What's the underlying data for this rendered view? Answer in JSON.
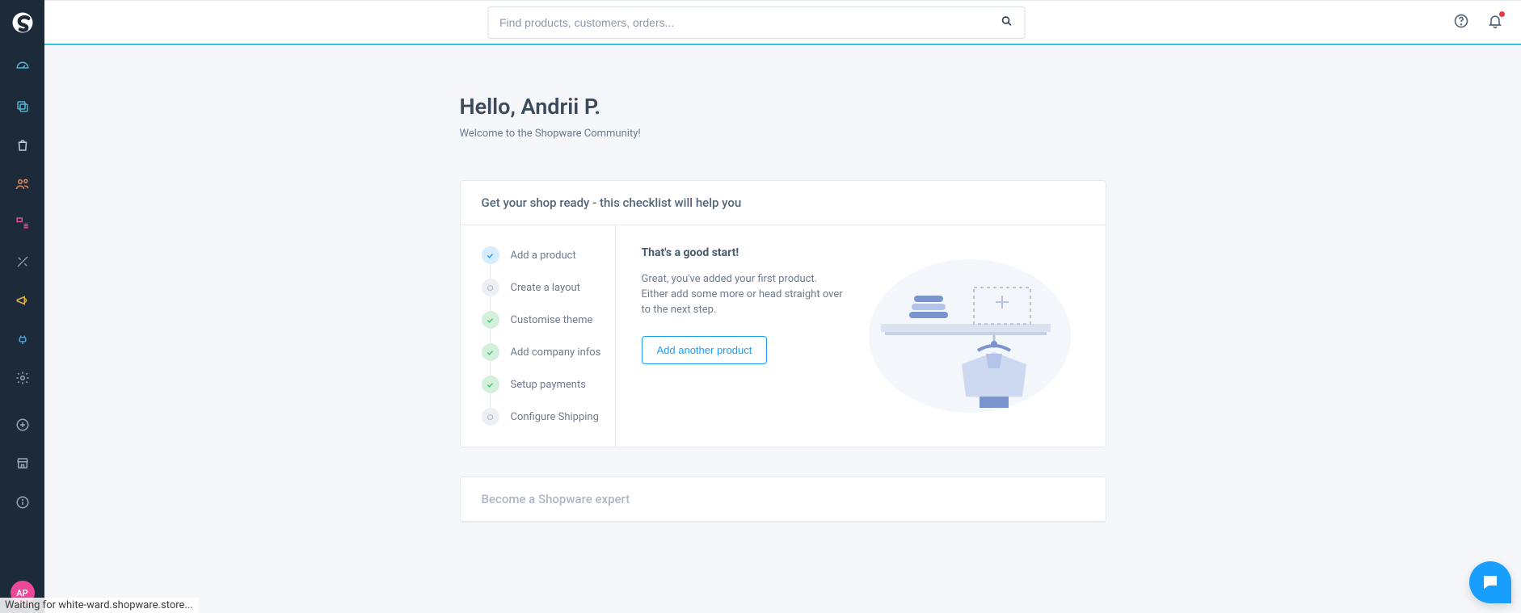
{
  "search": {
    "placeholder": "Find products, customers, orders..."
  },
  "avatar": {
    "initials": "AP"
  },
  "greeting": "Hello, Andrii P.",
  "welcome": "Welcome to the Shopware Community!",
  "checklist_card": {
    "title": "Get your shop ready - this checklist will help you",
    "items": [
      {
        "label": "Add a product",
        "state": "active"
      },
      {
        "label": "Create a layout",
        "state": "empty"
      },
      {
        "label": "Customise theme",
        "state": "done"
      },
      {
        "label": "Add company infos",
        "state": "done"
      },
      {
        "label": "Setup payments",
        "state": "done"
      },
      {
        "label": "Configure Shipping",
        "state": "empty"
      }
    ],
    "detail": {
      "title": "That's a good start!",
      "desc": "Great, you've added your first product. Either add some more or head straight over to the next step.",
      "cta": "Add another product"
    }
  },
  "expert_card": {
    "title": "Become a Shopware expert"
  },
  "status_text": "Waiting for white-ward.shopware.store..."
}
